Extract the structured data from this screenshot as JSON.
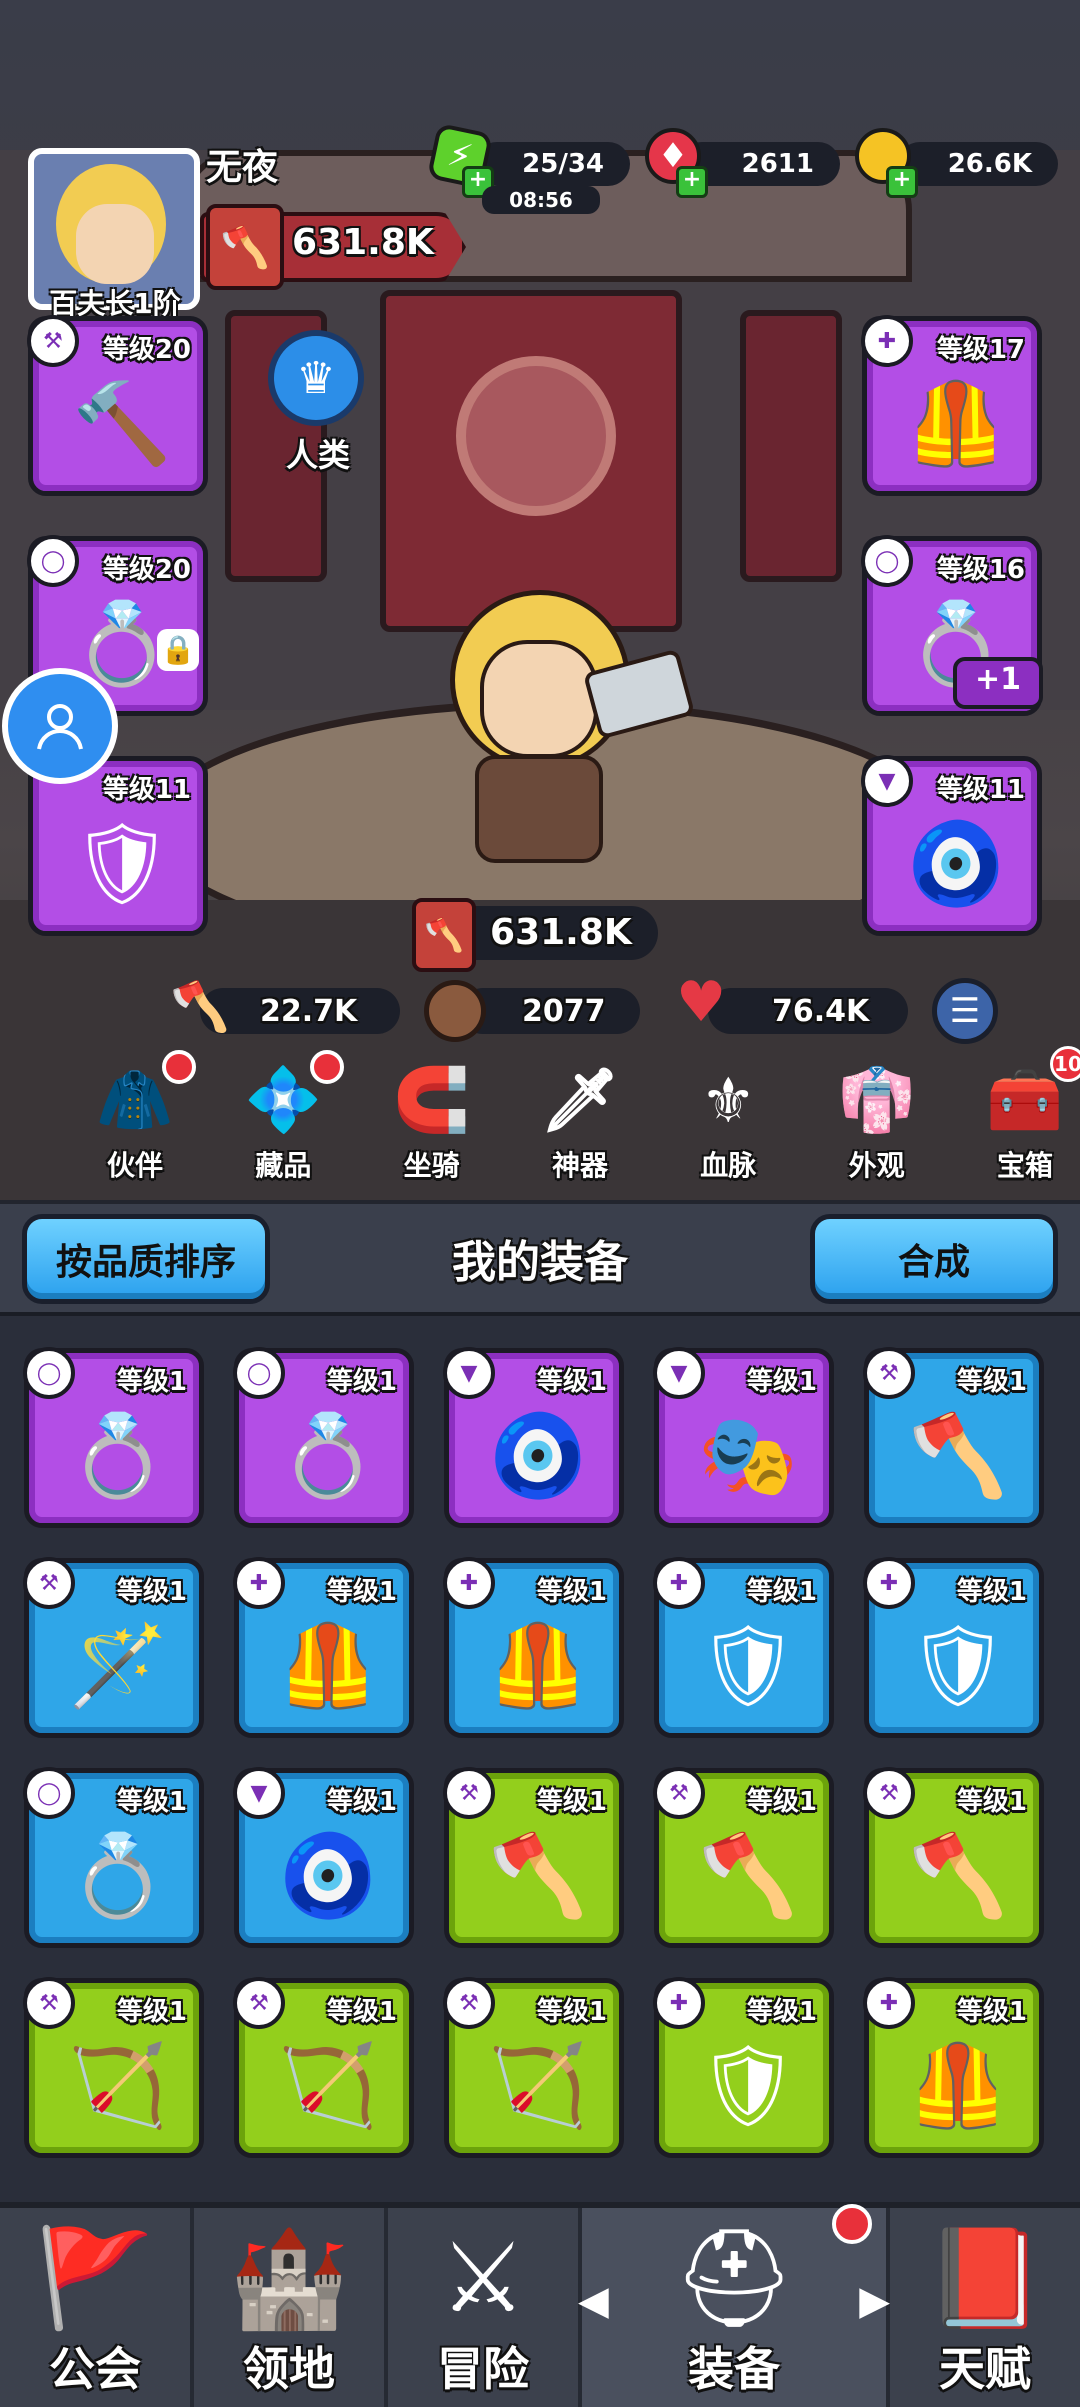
{
  "player": {
    "name": "无夜",
    "rank": "百夫长1阶",
    "power": "631.8K",
    "race": "人类"
  },
  "resources": {
    "energy": "25/34",
    "energy_timer": "08:56",
    "gems": "2611",
    "gold": "26.6K"
  },
  "equipped": {
    "left": [
      {
        "level": "等级20",
        "icon": "hammer"
      },
      {
        "level": "等级20",
        "icon": "ring-locked"
      },
      {
        "level": "等级11",
        "icon": "amulet"
      }
    ],
    "right": [
      {
        "level": "等级17",
        "icon": "armor"
      },
      {
        "level": "等级16",
        "icon": "ring",
        "extra": "+1"
      },
      {
        "level": "等级11",
        "icon": "amulet-blue"
      }
    ]
  },
  "stats": {
    "power": "631.8K",
    "attack": "22.7K",
    "defense": "2077",
    "hp": "76.4K"
  },
  "features": [
    {
      "label": "伙伴",
      "icon": "hood",
      "dot": true
    },
    {
      "label": "藏品",
      "icon": "gem",
      "dot": true
    },
    {
      "label": "坐骑",
      "icon": "horseshoe",
      "dot": false
    },
    {
      "label": "神器",
      "icon": "sword",
      "dot": false
    },
    {
      "label": "血脉",
      "icon": "crest",
      "dot": false
    },
    {
      "label": "外观",
      "icon": "cloak",
      "dot": false
    },
    {
      "label": "宝箱",
      "icon": "chest",
      "count": "10"
    }
  ],
  "inventory_header": {
    "sort_label": "按品质排序",
    "title": "我的装备",
    "merge_label": "合成"
  },
  "inventory": [
    {
      "level": "等级1",
      "rarity": "purple",
      "icon": "ring"
    },
    {
      "level": "等级1",
      "rarity": "purple",
      "icon": "ring-blue"
    },
    {
      "level": "等级1",
      "rarity": "purple",
      "icon": "amulet"
    },
    {
      "level": "等级1",
      "rarity": "purple",
      "icon": "mask"
    },
    {
      "level": "等级1",
      "rarity": "blue",
      "icon": "axe"
    },
    {
      "level": "等级1",
      "rarity": "blue",
      "icon": "staff"
    },
    {
      "level": "等级1",
      "rarity": "blue",
      "icon": "vest"
    },
    {
      "level": "等级1",
      "rarity": "blue",
      "icon": "vest"
    },
    {
      "level": "等级1",
      "rarity": "blue",
      "icon": "armor"
    },
    {
      "level": "等级1",
      "rarity": "blue",
      "icon": "armor"
    },
    {
      "level": "等级1",
      "rarity": "blue",
      "icon": "ring-blue"
    },
    {
      "level": "等级1",
      "rarity": "blue",
      "icon": "amulet"
    },
    {
      "level": "等级1",
      "rarity": "green",
      "icon": "axe"
    },
    {
      "level": "等级1",
      "rarity": "green",
      "icon": "axe"
    },
    {
      "level": "等级1",
      "rarity": "green",
      "icon": "axe"
    },
    {
      "level": "等级1",
      "rarity": "green",
      "icon": "bow"
    },
    {
      "level": "等级1",
      "rarity": "green",
      "icon": "bow"
    },
    {
      "level": "等级1",
      "rarity": "green",
      "icon": "bow"
    },
    {
      "level": "等级1",
      "rarity": "green",
      "icon": "armor"
    },
    {
      "level": "等级1",
      "rarity": "green",
      "icon": "vest"
    }
  ],
  "bottom_nav": [
    {
      "label": "公会",
      "icon": "banner"
    },
    {
      "label": "领地",
      "icon": "castle"
    },
    {
      "label": "冒险",
      "icon": "crossed-axes"
    },
    {
      "label": "装备",
      "icon": "helmet",
      "active": true,
      "dot": true
    },
    {
      "label": "天赋",
      "icon": "book"
    }
  ],
  "colors": {
    "purple": "#b34ee6",
    "blue": "#2fa6e8",
    "green": "#93cf1c",
    "red_dot": "#e8303a"
  }
}
